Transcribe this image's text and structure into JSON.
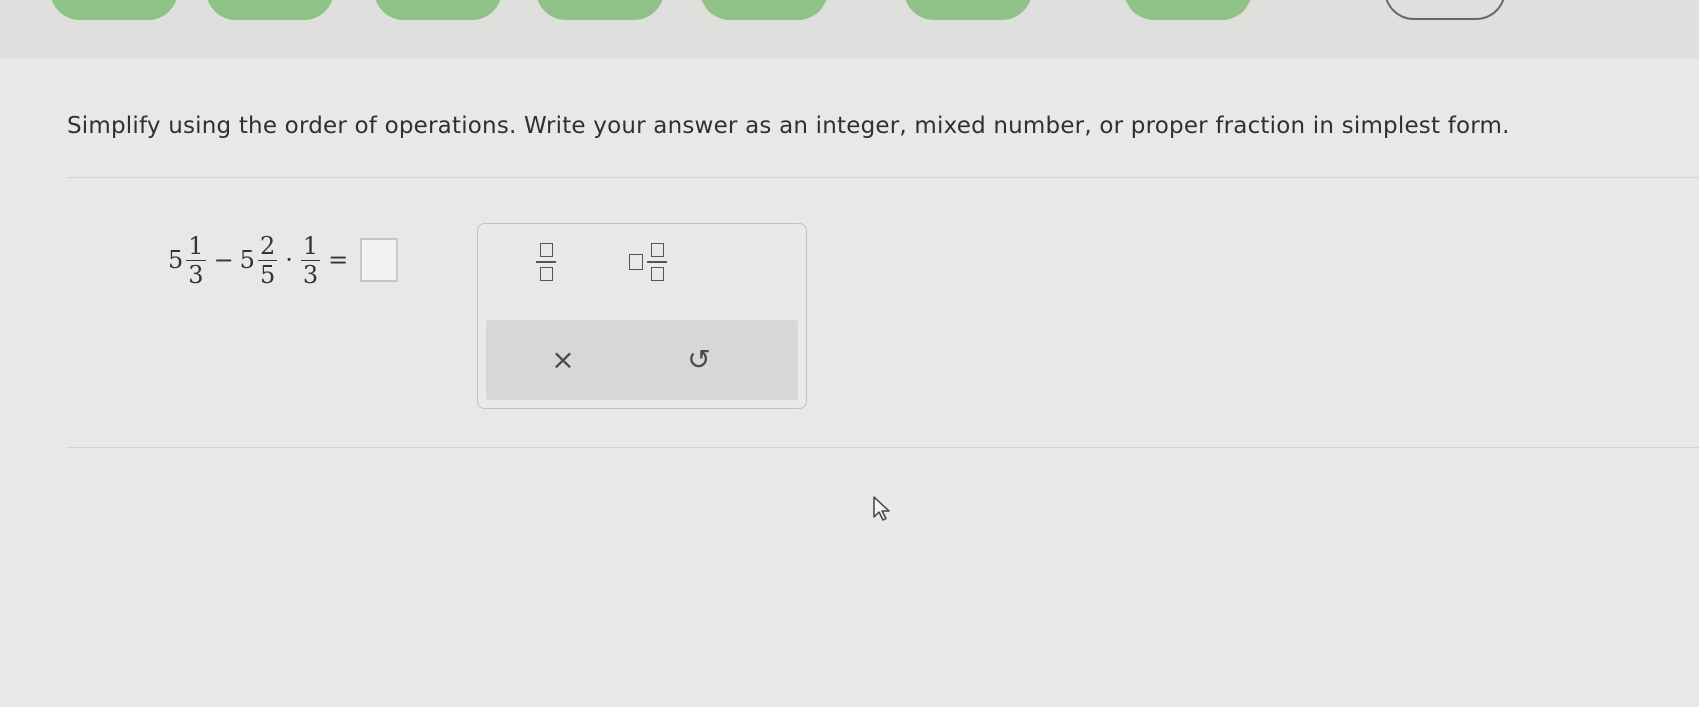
{
  "instruction": "Simplify using the order of operations. Write your answer as an integer, mixed number, or proper fraction in simplest form.",
  "problem": {
    "term1": {
      "whole": "5",
      "numerator": "1",
      "denominator": "3"
    },
    "minus": "−",
    "term2": {
      "whole": "5",
      "numerator": "2",
      "denominator": "5"
    },
    "times": "·",
    "term3": {
      "numerator": "1",
      "denominator": "3"
    },
    "equals": "="
  },
  "answer": {
    "value": ""
  },
  "palette": {
    "tools": [
      {
        "icon": "fraction-template-icon"
      },
      {
        "icon": "mixed-number-template-icon"
      }
    ],
    "clear_symbol": "×",
    "undo_symbol": "↺"
  },
  "colors": {
    "tab_green": "#8fc286",
    "background": "#e8e8e7",
    "action_bar": "#d7d7d6"
  }
}
